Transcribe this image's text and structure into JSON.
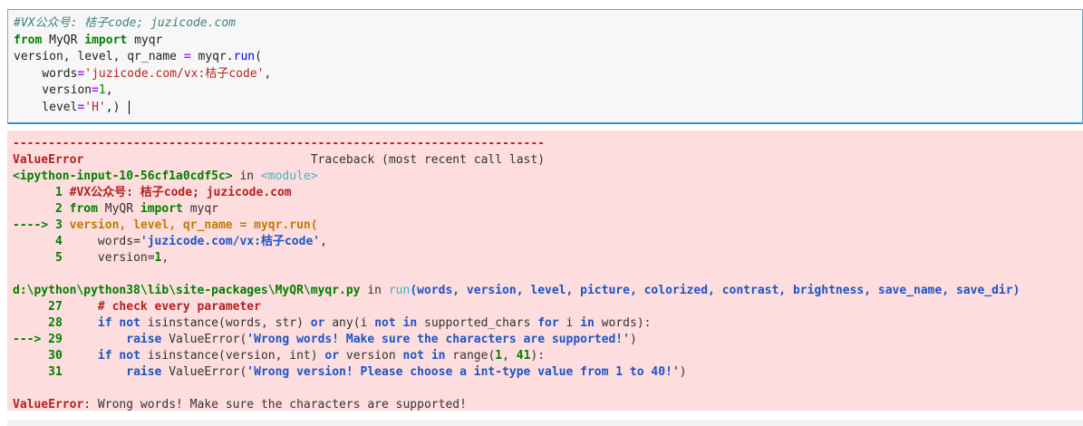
{
  "code_cell": {
    "line1": "#VX公众号: 桔子code; juzicode.com",
    "line2_kw1": "from",
    "line2_mod": " MyQR ",
    "line2_kw2": "import",
    "line2_name": " myqr",
    "line3_a": "version, level, qr_name ",
    "line3_eq": "=",
    "line3_b": " myqr.",
    "line3_fn": "run",
    "line3_c": "(",
    "line4_a": "    words",
    "line4_eq": "=",
    "line4_str": "'juzicode.com/vx:桔子code'",
    "line4_c": ",",
    "line5_a": "    version",
    "line5_eq": "=",
    "line5_num": "1",
    "line5_c": ",",
    "line6_a": "    level",
    "line6_eq": "=",
    "line6_str": "'H'",
    "line6_c": ",) "
  },
  "error_output": {
    "dashes": "---------------------------------------------------------------------------",
    "error_name": "ValueError",
    "traceback_gap": "                                Traceback (most recent call last)",
    "ipy_input": "<ipython-input-10-56cf1a0cdf5c>",
    "in_word": " in ",
    "module": "<module>",
    "f1_l1_num": "      1 ",
    "f1_l1_text": "#VX公众号: 桔子code; juzicode.com",
    "f1_l2_num": "      2 ",
    "f1_l2_kw1": "from",
    "f1_l2_mod": " MyQR ",
    "f1_l2_kw2": "import",
    "f1_l2_name": " myqr",
    "f1_l3_arrow": "----> 3 ",
    "f1_l3_text": "version, level, qr_name = myqr.run(",
    "f1_l4_num": "      4 ",
    "f1_l4_a": "    words=",
    "f1_l4_str": "'juzicode.com/vx:桔子code'",
    "f1_l4_c": ",",
    "f1_l5_num": "      5 ",
    "f1_l5_a": "    version=",
    "f1_l5_num_val": "1",
    "f1_l5_c": ",",
    "path": "d:\\python\\python38\\lib\\site-packages\\MyQR\\myqr.py",
    "in_word2": " in ",
    "run_fn": "run",
    "run_args": "(words, version, level, picture, colorized, contrast, brightness, save_name, save_dir)",
    "f2_l27_num": "     27 ",
    "f2_l27_text": "    # check every parameter",
    "f2_l28_num": "     28 ",
    "f2_l28_a": "    if not",
    "f2_l28_b": " isinstance(words, str) ",
    "f2_l28_c": "or",
    "f2_l28_d": " any(i ",
    "f2_l28_e": "not in",
    "f2_l28_f": " supported_chars ",
    "f2_l28_g": "for",
    "f2_l28_h": " i ",
    "f2_l28_i": "in",
    "f2_l28_j": " words):",
    "f2_l29_arrow": "---> 29 ",
    "f2_l29_a": "        raise",
    "f2_l29_b": " ValueError(",
    "f2_l29_str": "'Wrong words! Make sure the characters are supported!'",
    "f2_l29_c": ")",
    "f2_l30_num": "     30 ",
    "f2_l30_a": "    if not",
    "f2_l30_b": " isinstance(version, int) ",
    "f2_l30_c": "or",
    "f2_l30_d": " version ",
    "f2_l30_e": "not in",
    "f2_l30_f": " range(",
    "f2_l30_g": "1",
    "f2_l30_h": ", ",
    "f2_l30_i": "41",
    "f2_l30_j": "):",
    "f2_l31_num": "     31 ",
    "f2_l31_a": "        raise",
    "f2_l31_b": " ValueError(",
    "f2_l31_str": "'Wrong version! Please choose a int-type value from 1 to 40!'",
    "f2_l31_c": ")",
    "final_name": "ValueError",
    "final_msg": ": Wrong words! Make sure the characters are supported!"
  }
}
